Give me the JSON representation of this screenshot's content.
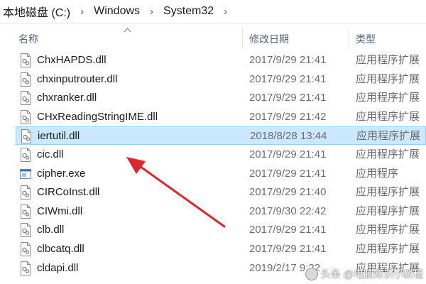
{
  "breadcrumb": [
    "本地磁盘 (C:)",
    "Windows",
    "System32"
  ],
  "columns": {
    "name": "名称",
    "date": "修改日期",
    "type": "类型"
  },
  "files": [
    {
      "name": "ChxHAPDS.dll",
      "date": "2017/9/29 21:41",
      "type": "应用程序扩展",
      "icon": "dll-file-icon"
    },
    {
      "name": "chxinputrouter.dll",
      "date": "2017/9/29 21:41",
      "type": "应用程序扩展",
      "icon": "dll-file-icon"
    },
    {
      "name": "chxranker.dll",
      "date": "2017/9/29 21:41",
      "type": "应用程序扩展",
      "icon": "dll-file-icon"
    },
    {
      "name": "CHxReadingStringIME.dll",
      "date": "2017/9/29 21:42",
      "type": "应用程序扩展",
      "icon": "dll-file-icon"
    },
    {
      "name": "iertutil.dll",
      "date": "2018/8/28 13:44",
      "type": "应用程序扩展",
      "icon": "dll-file-icon",
      "selected": true
    },
    {
      "name": "cic.dll",
      "date": "2017/9/29 21:41",
      "type": "应用程序扩展",
      "icon": "dll-file-icon"
    },
    {
      "name": "cipher.exe",
      "date": "2017/9/29 21:41",
      "type": "应用程序",
      "icon": "exe-file-icon"
    },
    {
      "name": "CIRCoInst.dll",
      "date": "2017/9/29 21:40",
      "type": "应用程序扩展",
      "icon": "dll-file-icon"
    },
    {
      "name": "CIWmi.dll",
      "date": "2017/9/30 22:42",
      "type": "应用程序扩展",
      "icon": "dll-file-icon"
    },
    {
      "name": "clb.dll",
      "date": "2017/9/29 21:41",
      "type": "应用程序扩展",
      "icon": "dll-file-icon"
    },
    {
      "name": "clbcatq.dll",
      "date": "2017/9/29 21:41",
      "type": "应用程序扩展",
      "icon": "dll-file-icon"
    },
    {
      "name": "cldapi.dll",
      "date": "2019/2/17 9:22",
      "type": "应用程序扩展",
      "icon": "dll-file-icon"
    }
  ],
  "watermark": "头条 @电脑知识小教程",
  "colors": {
    "selection": "#cce8ff",
    "selection_border": "#99d1ff",
    "arrow": "#e0262a",
    "header_text": "#4c607a"
  }
}
